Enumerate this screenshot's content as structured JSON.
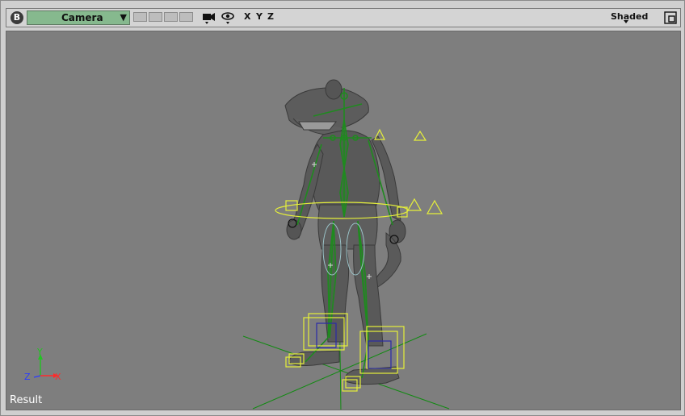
{
  "toolbar": {
    "view_button_label": "B",
    "camera_label": "Camera",
    "axis_x_label": "X",
    "axis_y_label": "Y",
    "axis_z_label": "Z",
    "shading_mode_label": "Shaded"
  },
  "viewport": {
    "background_color": "#7e7e7e",
    "status_label": "Result",
    "gizmo": {
      "x_label": "X",
      "y_label": "Y",
      "z_label": "Z"
    }
  },
  "colors": {
    "skeleton_green": "#1f8a1f",
    "control_yellow": "#e6f03a",
    "constraint_blue": "#2a2aa8",
    "grid_green": "#128a12",
    "axis_x_red": "#ff2a2a",
    "axis_y_green": "#22c422",
    "axis_z_blue": "#2a3cff"
  }
}
